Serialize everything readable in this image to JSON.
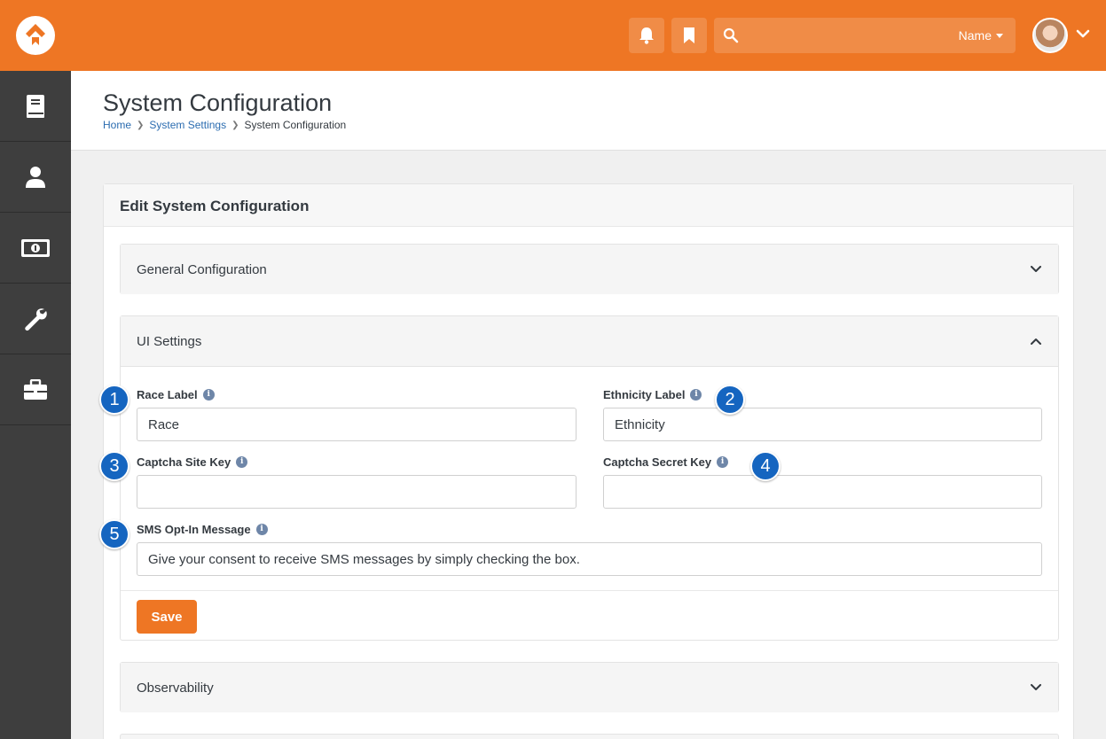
{
  "topbar": {
    "search": {
      "placeholder": "",
      "filter_label": "Name"
    }
  },
  "sidebar": {
    "items": [
      {
        "icon": "book-icon"
      },
      {
        "icon": "person-icon"
      },
      {
        "icon": "money-icon"
      },
      {
        "icon": "wrench-icon"
      },
      {
        "icon": "briefcase-icon"
      }
    ]
  },
  "header": {
    "title": "System Configuration",
    "breadcrumb": [
      "Home",
      "System Settings",
      "System Configuration"
    ]
  },
  "panel": {
    "title": "Edit System Configuration",
    "sections": {
      "general": {
        "title": "General Configuration",
        "expanded": false
      },
      "ui": {
        "title": "UI Settings",
        "expanded": true,
        "fields": {
          "race_label": {
            "label": "Race Label",
            "value": "Race"
          },
          "ethnicity_label": {
            "label": "Ethnicity Label",
            "value": "Ethnicity"
          },
          "captcha_site_key": {
            "label": "Captcha Site Key",
            "value": ""
          },
          "captcha_secret_key": {
            "label": "Captcha Secret Key",
            "value": ""
          },
          "sms_opt_in": {
            "label": "SMS Opt-In Message",
            "value": "Give your consent to receive SMS messages by simply checking the box."
          }
        },
        "save_label": "Save"
      },
      "observability": {
        "title": "Observability",
        "expanded": false
      }
    }
  },
  "callouts": [
    "1",
    "2",
    "3",
    "4",
    "5"
  ],
  "colors": {
    "brand": "#ee7624",
    "sidebar": "#3e3e3e",
    "callout": "#1565c0",
    "link": "#2b6cb0"
  }
}
